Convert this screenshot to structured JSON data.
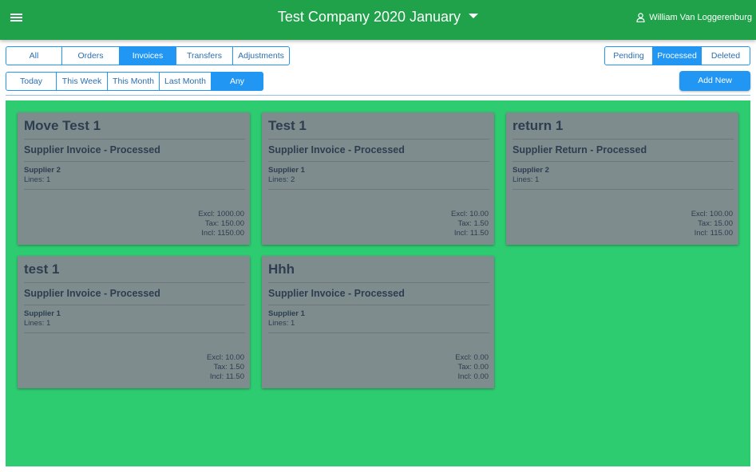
{
  "header": {
    "menu_icon": "hamburger-icon",
    "company_title": "Test Company 2020 January",
    "user_icon": "user-icon",
    "user_name": "William Van Loggerenburg"
  },
  "type_tabs": [
    {
      "label": "All",
      "active": false
    },
    {
      "label": "Orders",
      "active": false
    },
    {
      "label": "Invoices",
      "active": true
    },
    {
      "label": "Transfers",
      "active": false
    },
    {
      "label": "Adjustments",
      "active": false
    }
  ],
  "period_tabs": [
    {
      "label": "Today",
      "active": false
    },
    {
      "label": "This Week",
      "active": false
    },
    {
      "label": "This Month",
      "active": false
    },
    {
      "label": "Last Month",
      "active": false
    },
    {
      "label": "Any",
      "active": true
    }
  ],
  "status_tabs": [
    {
      "label": "Pending",
      "active": false
    },
    {
      "label": "Processed",
      "active": true
    },
    {
      "label": "Deleted",
      "active": false
    }
  ],
  "add_new_label": "Add New",
  "colors": {
    "header": "#20a24b",
    "accent": "#2196f3",
    "area": "#2ecc71",
    "card": "#7f8c8d",
    "card_text": "#2c3e50"
  },
  "cards": [
    {
      "title": "Move Test 1",
      "subtitle": "Supplier Invoice - Processed",
      "supplier": "Supplier 2",
      "lines": "Lines: 1",
      "excl": "Excl: 1000.00",
      "tax": "Tax: 150.00",
      "incl": "Incl: 1150.00"
    },
    {
      "title": "Test 1",
      "subtitle": "Supplier Invoice - Processed",
      "supplier": "Supplier 1",
      "lines": "Lines: 2",
      "excl": "Excl: 10.00",
      "tax": "Tax: 1.50",
      "incl": "Incl: 11.50"
    },
    {
      "title": "return 1",
      "subtitle": "Supplier Return - Processed",
      "supplier": "Supplier 2",
      "lines": "Lines: 1",
      "excl": "Excl: 100.00",
      "tax": "Tax: 15.00",
      "incl": "Incl: 115.00"
    },
    {
      "title": "test 1",
      "subtitle": "Supplier Invoice - Processed",
      "supplier": "Supplier 1",
      "lines": "Lines: 1",
      "excl": "Excl: 10.00",
      "tax": "Tax: 1.50",
      "incl": "Incl: 11.50"
    },
    {
      "title": "Hhh",
      "subtitle": "Supplier Invoice - Processed",
      "supplier": "Supplier 1",
      "lines": "Lines: 1",
      "excl": "Excl: 0.00",
      "tax": "Tax: 0.00",
      "incl": "Incl: 0.00"
    }
  ]
}
